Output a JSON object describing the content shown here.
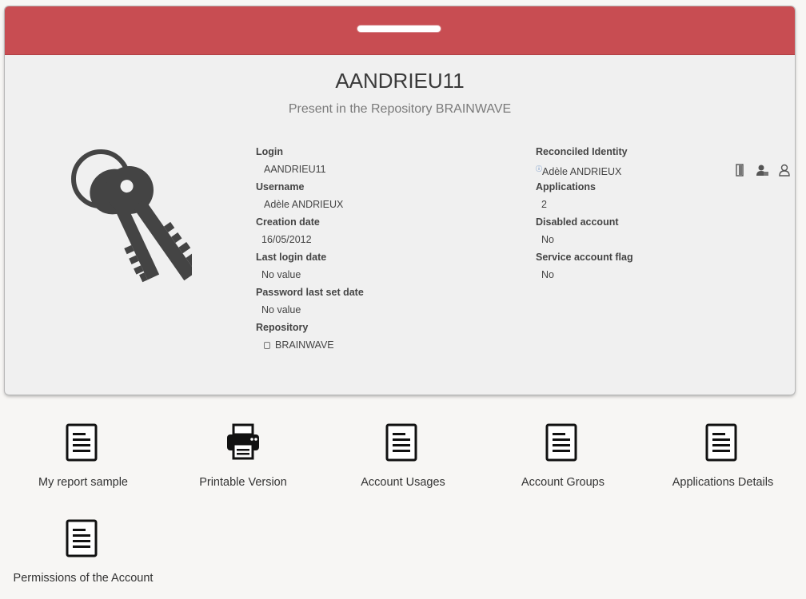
{
  "account": {
    "name": "AANDRIEU11",
    "subtitle": "Present in the Repository BRAINWAVE"
  },
  "details_left": [
    {
      "label": "Login",
      "value": "AANDRIEU11"
    },
    {
      "label": "Username",
      "value": "Adèle ANDRIEUX"
    },
    {
      "label": "Creation date",
      "value": "16/05/2012"
    },
    {
      "label": "Last login date",
      "value": "No value"
    },
    {
      "label": "Password last set date",
      "value": "No value"
    },
    {
      "label": "Repository",
      "value": "BRAINWAVE"
    }
  ],
  "details_right": [
    {
      "label": "Reconciled Identity",
      "value": "Adèle ANDRIEUX"
    },
    {
      "label": "Applications",
      "value": "2"
    },
    {
      "label": "Disabled account",
      "value": "No"
    },
    {
      "label": "Service account flag",
      "value": "No"
    }
  ],
  "icons": {
    "hero": "keys-icon",
    "repository": "database-icon",
    "identity_info": "info-icon",
    "actions": [
      "door-icon",
      "user-manager-icon",
      "user-icon"
    ]
  },
  "reports": [
    {
      "label": "My report sample",
      "icon": "document-icon"
    },
    {
      "label": "Printable Version",
      "icon": "printer-icon"
    },
    {
      "label": "Account Usages",
      "icon": "document-icon"
    },
    {
      "label": "Account Groups",
      "icon": "document-icon"
    },
    {
      "label": "Applications Details",
      "icon": "document-icon"
    },
    {
      "label": "Permissions of the Account",
      "icon": "document-icon"
    }
  ],
  "colors": {
    "header": "#c84d52",
    "card_bg": "#f0f0f0",
    "page_bg": "#f7f6f4"
  }
}
